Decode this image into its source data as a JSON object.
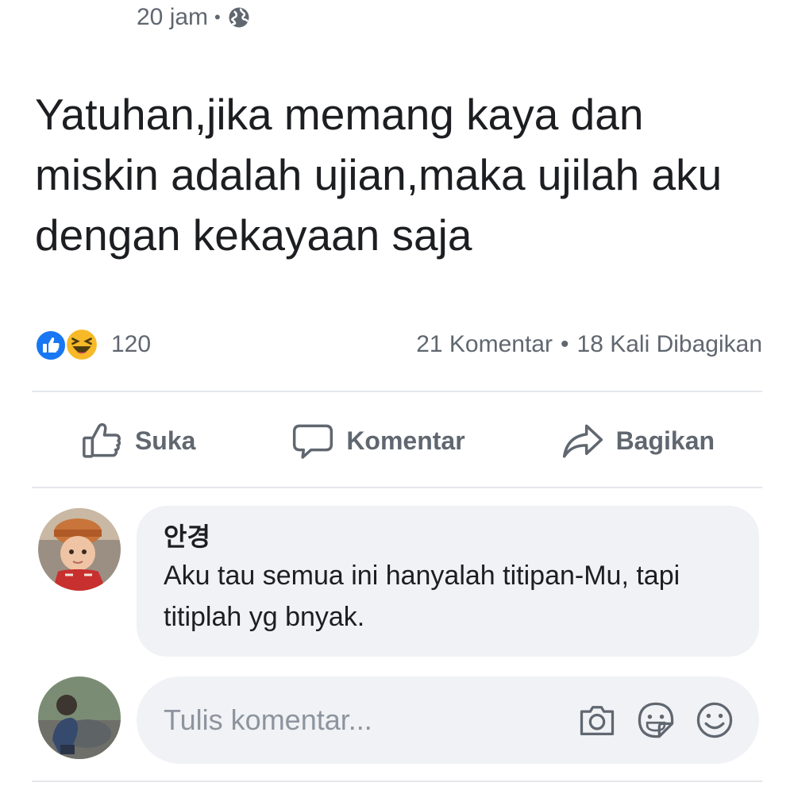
{
  "post": {
    "timestamp": "20 jam",
    "separator": "•",
    "privacy_icon": "globe-icon",
    "text": "Yatuhan,jika memang kaya dan miskin adalah ujian,maka ujilah aku dengan kekayaan saja"
  },
  "stats": {
    "reaction_icons": [
      "like-reaction-icon",
      "haha-reaction-icon"
    ],
    "reaction_count": "120",
    "comments": "21 Komentar",
    "separator": "•",
    "shares": "18 Kali Dibagikan"
  },
  "actions": {
    "like_label": "Suka",
    "comment_label": "Komentar",
    "share_label": "Bagikan"
  },
  "comment": {
    "author": "안경",
    "text": "Aku tau semua ini hanyalah titipan-Mu, tapi titiplah yg bnyak."
  },
  "composer": {
    "placeholder": "Tulis komentar...",
    "icons": [
      "camera-icon",
      "sticker-icon",
      "emoji-icon"
    ]
  },
  "colors": {
    "like_blue": "#1877f2",
    "haha_yellow": "#f7b928",
    "secondary_text": "#606770",
    "bubble_bg": "#f0f2f5"
  }
}
